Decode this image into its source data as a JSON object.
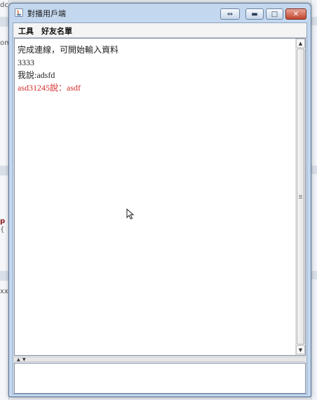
{
  "window": {
    "title": "對播用戶端",
    "colors": {
      "titlebar": "#c3d7ee",
      "close": "#c2462e",
      "highlight": "#d62b2b",
      "text": "#222222"
    }
  },
  "menubar": {
    "items": [
      {
        "label": "工具"
      },
      {
        "label": "好友名單"
      }
    ]
  },
  "chat": {
    "lines": [
      {
        "text": "完成連線，可開始輸入資料",
        "color": "#222222"
      },
      {
        "text": "3333",
        "color": "#222222"
      },
      {
        "text": "我說:adsfd",
        "color": "#222222"
      },
      {
        "text": "asd31245說：asdf",
        "color": "#d62b2b"
      }
    ]
  },
  "input": {
    "value": ""
  },
  "background": {
    "fragments": [
      "dc",
      "om",
      "p",
      "{",
      "xx"
    ]
  }
}
